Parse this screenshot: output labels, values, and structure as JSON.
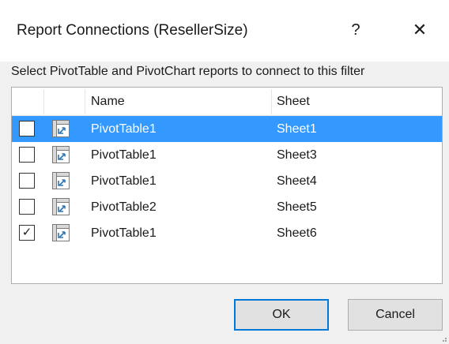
{
  "dialog": {
    "title": "Report Connections (ResellerSize)",
    "help_label": "?",
    "close_label": "✕",
    "prompt": "Select PivotTable and PivotChart reports to connect to this filter"
  },
  "table": {
    "headers": {
      "name": "Name",
      "sheet": "Sheet"
    },
    "rows": [
      {
        "checked": false,
        "selected": true,
        "name": "PivotTable1",
        "sheet": "Sheet1",
        "check_glyph": "",
        "icon": "pivottable-icon"
      },
      {
        "checked": false,
        "selected": false,
        "name": "PivotTable1",
        "sheet": "Sheet3",
        "check_glyph": "",
        "icon": "pivottable-icon"
      },
      {
        "checked": false,
        "selected": false,
        "name": "PivotTable1",
        "sheet": "Sheet4",
        "check_glyph": "",
        "icon": "pivottable-icon"
      },
      {
        "checked": false,
        "selected": false,
        "name": "PivotTable2",
        "sheet": "Sheet5",
        "check_glyph": "",
        "icon": "pivottable-icon"
      },
      {
        "checked": true,
        "selected": false,
        "name": "PivotTable1",
        "sheet": "Sheet6",
        "check_glyph": "✓",
        "icon": "pivottable-icon"
      }
    ]
  },
  "buttons": {
    "ok": "OK",
    "cancel": "Cancel"
  },
  "colors": {
    "selection": "#3399ff",
    "ok_border": "#0078d7",
    "background": "#f0f0f0"
  }
}
